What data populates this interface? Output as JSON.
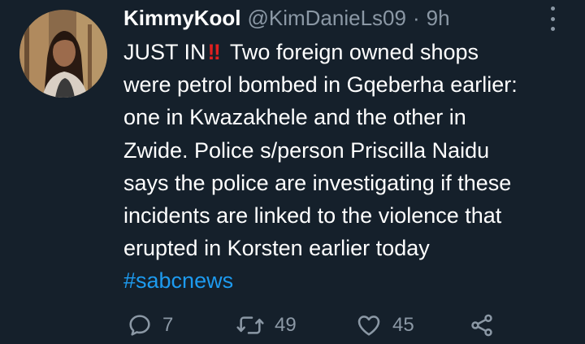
{
  "tweet": {
    "display_name": "KimmyKool",
    "handle": "@KimDanieLs09",
    "separator": "·",
    "time": "9h",
    "text_lines": [
      "JUST IN",
      "were petrol bombed in Gqeberha earlier:",
      "one in Kwazakhele and the other in",
      "Zwide. Police s/person Priscilla Naidu",
      "says the police are investigating if these",
      "incidents are linked to the violence that",
      "erupted in Korsten earlier today"
    ],
    "first_line_suffix": "Two foreign owned shops",
    "emoji": "‼",
    "hashtag": "#sabcnews"
  },
  "actions": {
    "reply": {
      "icon": "reply-icon",
      "count": "7"
    },
    "retweet": {
      "icon": "retweet-icon",
      "count": "49"
    },
    "like": {
      "icon": "heart-icon",
      "count": "45"
    },
    "share": {
      "icon": "share-icon"
    }
  },
  "colors": {
    "background": "#15202b",
    "text": "#ffffff",
    "secondary": "#8b98a5",
    "hashtag": "#1d9bf0",
    "emoji_red": "#e02020"
  }
}
